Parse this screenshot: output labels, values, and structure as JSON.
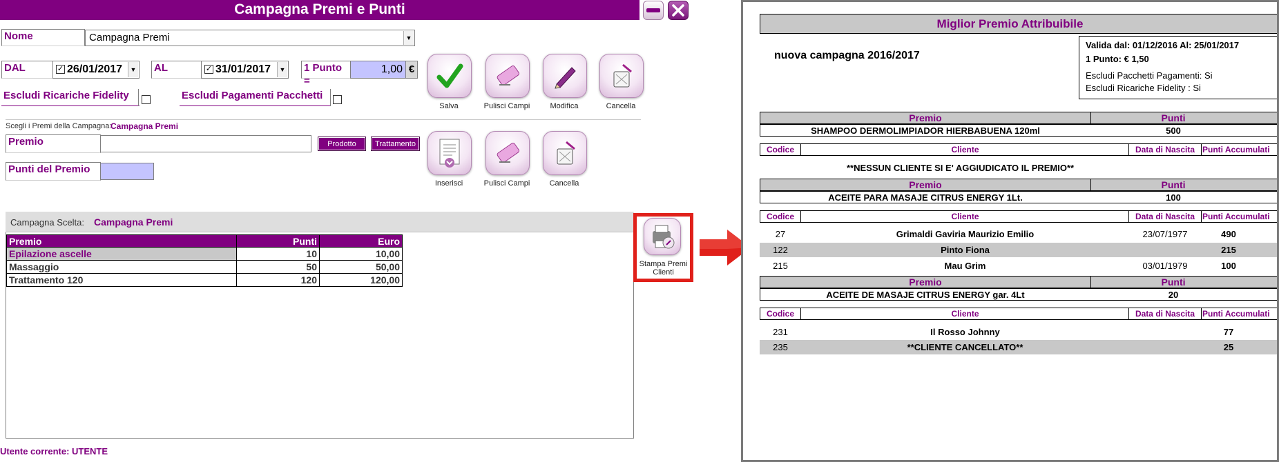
{
  "window": {
    "title": "Campagna Premi e Punti"
  },
  "form": {
    "nome_label": "Nome",
    "nome_value": "Campagna Premi",
    "dal_label": "DAL",
    "dal_value": "26/01/2017",
    "al_label": "AL",
    "al_value": "31/01/2017",
    "punto_label": "1 Punto =",
    "punto_value": "1,00",
    "currency": "€",
    "escludi_ricariche_label": "Escludi Ricariche Fidelity",
    "escludi_pagamenti_label": "Escludi Pagamenti Pacchetti"
  },
  "actions": {
    "salva": "Salva",
    "pulisci": "Pulisci Campi",
    "modifica": "Modifica",
    "cancella": "Cancella"
  },
  "premi": {
    "choose_label": "Scegli i Premi della Campagna:",
    "choose_value": "Campagna Premi",
    "premio_label": "Premio",
    "prodotto_btn": "Prodotto",
    "trattamento_btn": "Trattamento",
    "punti_label": "Punti del Premio",
    "inserisci": "Inserisci",
    "pulisci": "Pulisci Campi",
    "cancella": "Cancella"
  },
  "campagna_scelta": {
    "label": "Campagna Scelta:",
    "value": "Campagna Premi",
    "columns": [
      "Premio",
      "Punti",
      "Euro"
    ],
    "rows": [
      {
        "premio": "Epilazione ascelle",
        "punti": "10",
        "euro": "10,00"
      },
      {
        "premio": "Massaggio",
        "punti": "50",
        "euro": "50,00"
      },
      {
        "premio": "Trattamento 120",
        "punti": "120",
        "euro": "120,00"
      }
    ]
  },
  "stampa_label": "Stampa Premi Clienti",
  "status": {
    "text": "Utente corrente: UTENTE"
  },
  "colors": {
    "brand": "#800080",
    "highlight": "#e0201a",
    "field_blue": "#c4c4ff"
  },
  "report": {
    "title": "Miglior Premio Attribuibile",
    "campaign": "nuova campagna 2016/2017",
    "validity": "Valida dal: 01/12/2016 Al: 25/01/2017",
    "punto": "1 Punto: € 1,50",
    "escludi_pacchetti": "Escludi Pacchetti Pagamenti: Si",
    "escludi_ricariche": "Escludi Ricariche Fidelity : Si",
    "h_premio": "Premio",
    "h_punti": "Punti",
    "h_codice": "Codice",
    "h_cliente": "Cliente",
    "h_nascita": "Data di Nascita",
    "h_accumulati": "Punti Accumulati",
    "groups": [
      {
        "premio": "SHAMPOO DERMOLIMPIADOR HIERBABUENA 120ml",
        "punti": "500",
        "empty": "**NESSUN CLIENTE SI E' AGGIUDICATO IL PREMIO**",
        "clients": []
      },
      {
        "premio": "ACEITE PARA MASAJE CITRUS ENERGY 1Lt.",
        "punti": "100",
        "clients": [
          {
            "codice": "27",
            "cliente": "Grimaldi Gaviria Maurizio Emilio",
            "nascita": "23/07/1977",
            "punti": "490"
          },
          {
            "codice": "122",
            "cliente": "Pinto Fiona",
            "nascita": "",
            "punti": "215"
          },
          {
            "codice": "215",
            "cliente": "Mau Grim",
            "nascita": "03/01/1979",
            "punti": "100"
          }
        ]
      },
      {
        "premio": "ACEITE DE MASAJE CITRUS ENERGY gar. 4Lt",
        "punti": "20",
        "clients": [
          {
            "codice": "231",
            "cliente": "Il Rosso Johnny",
            "nascita": "",
            "punti": "77"
          },
          {
            "codice": "235",
            "cliente": "**CLIENTE CANCELLATO**",
            "nascita": "",
            "punti": "25"
          }
        ]
      }
    ]
  }
}
